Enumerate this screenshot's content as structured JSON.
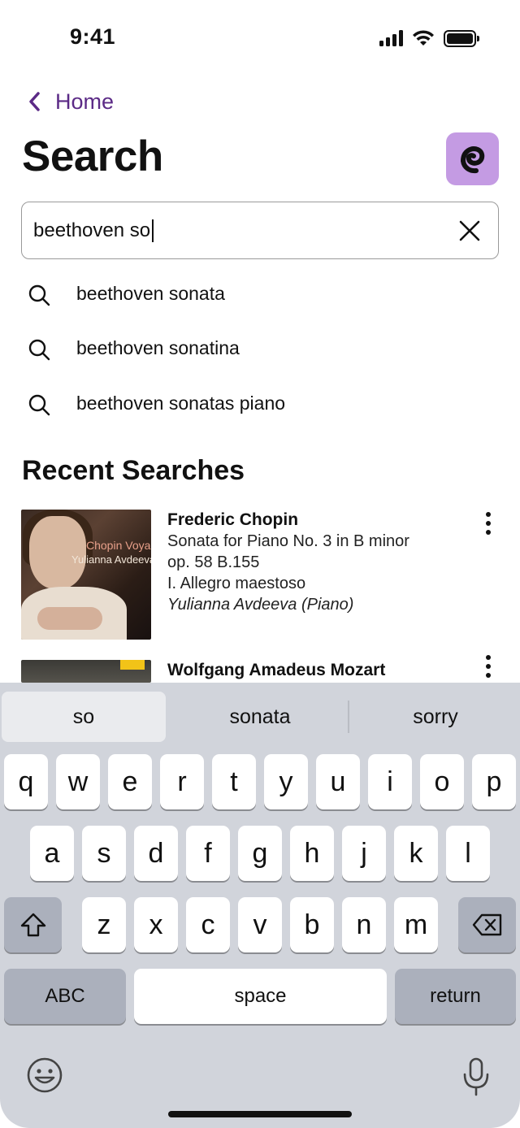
{
  "status_bar": {
    "time": "9:41"
  },
  "nav": {
    "back_label": "Home"
  },
  "page_title": "Search",
  "search": {
    "value": "beethoven so"
  },
  "suggestions": [
    "beethoven sonata",
    "beethoven sonatina",
    "beethoven sonatas piano"
  ],
  "recent_title": "Recent Searches",
  "recent": [
    {
      "composer": "Frederic Chopin",
      "work_line1": "Sonata for Piano No. 3 in B minor",
      "work_line2": "op. 58 B.155",
      "movement": "I. Allegro maestoso",
      "performer": "Yulianna Avdeeva",
      "role": "(Piano)",
      "cover_text1": "Chopin Voyage",
      "cover_text2": "Yulianna Avdeeva"
    },
    {
      "composer": "Wolfgang Amadeus Mozart"
    }
  ],
  "keyboard": {
    "predictions": [
      "so",
      "sonata",
      "sorry"
    ],
    "row1": [
      "q",
      "w",
      "e",
      "r",
      "t",
      "y",
      "u",
      "i",
      "o",
      "p"
    ],
    "row2": [
      "a",
      "s",
      "d",
      "f",
      "g",
      "h",
      "j",
      "k",
      "l"
    ],
    "row3": [
      "z",
      "x",
      "c",
      "v",
      "b",
      "n",
      "m"
    ],
    "abc_label": "ABC",
    "space_label": "space",
    "return_label": "return"
  },
  "colors": {
    "accent": "#5b2a86",
    "logo_bg": "#c49be3",
    "keyboard_bg": "#d1d4db"
  }
}
